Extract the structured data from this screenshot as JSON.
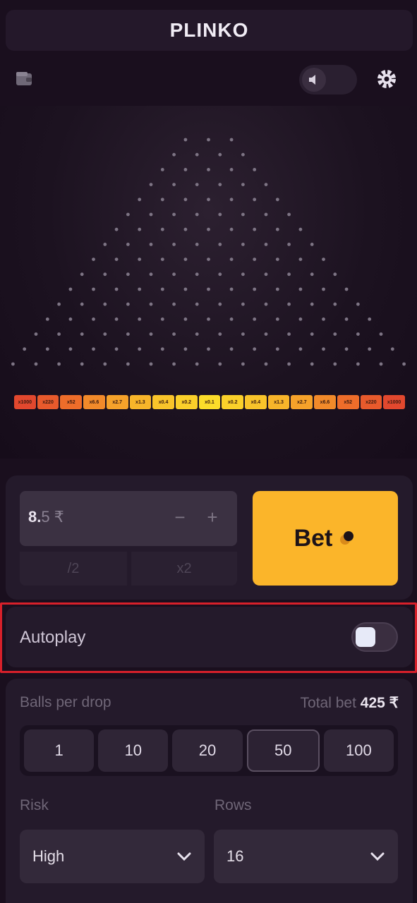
{
  "header": {
    "title": "PLINKO"
  },
  "icons": {
    "wallet": "wallet-icon",
    "sound": "sound-icon",
    "settings": "gear-icon"
  },
  "board": {
    "peg_rows": 16,
    "multipliers": [
      "x1000",
      "x220",
      "x52",
      "x6.6",
      "x2.7",
      "x1.3",
      "x0.4",
      "x0.2",
      "x0.1",
      "x0.2",
      "x0.4",
      "x1.3",
      "x2.7",
      "x6.6",
      "x52",
      "x220",
      "x1000"
    ]
  },
  "bet": {
    "amount_main": "8.",
    "amount_rest": "5 ₹",
    "minus": "−",
    "plus": "+",
    "half": "/2",
    "double": "x2",
    "bet_label": "Bet"
  },
  "autoplay": {
    "label": "Autoplay",
    "enabled": false
  },
  "balls": {
    "label": "Balls per drop",
    "total_label": "Total bet",
    "total_value": "425 ₹",
    "options": [
      "1",
      "10",
      "20",
      "50",
      "100"
    ],
    "selected": "50"
  },
  "risk": {
    "label": "Risk",
    "value": "High"
  },
  "rows": {
    "label": "Rows",
    "value": "16"
  },
  "colors": {
    "accent": "#fbb52a",
    "highlight": "#d8202a"
  }
}
